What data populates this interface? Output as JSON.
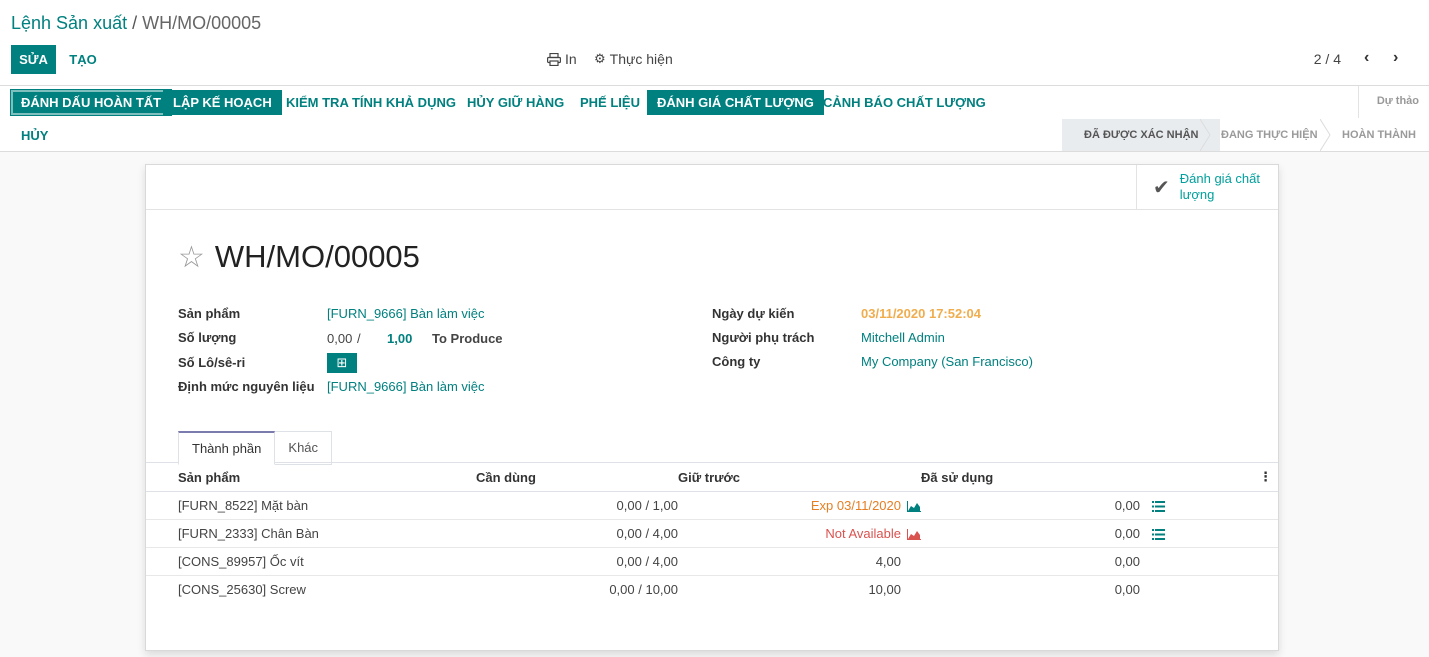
{
  "breadcrumb": {
    "parent": "Lệnh Sản xuất",
    "separator": "/",
    "current": "WH/MO/00005"
  },
  "toolbar": {
    "edit_label": "Sửa",
    "create_label": "Tạo",
    "print_label": "In",
    "action_label": "Thực hiện",
    "pager": "2 / 4"
  },
  "statusbar": {
    "buttons": [
      "Đánh dấu hoàn tất",
      "Lập kế hoạch",
      "Kiểm tra tính khả dụng",
      "Hủy giữ hàng",
      "Phế liệu",
      "Đánh giá chất lượng",
      "Cảnh báo chất lượng"
    ],
    "cancel_label": "Hủy",
    "stages": {
      "draft": "Dự thảo",
      "confirmed": "Đã được xác nhận",
      "progress": "Đang thực hiện",
      "done": "Hoàn thành"
    }
  },
  "smart_button": {
    "label": "Đánh giá chất lượng"
  },
  "record": {
    "name": "WH/MO/00005"
  },
  "fields": {
    "product_label": "Sản phẩm",
    "product_value": "[FURN_9666] Bàn làm việc",
    "qty_label": "Số lượng",
    "qty_produced": "0,00",
    "qty_sep": "/",
    "qty_total": "1,00",
    "qty_suffix": "To Produce",
    "lot_label": "Số Lô/sê-ri",
    "bom_label": "Định mức nguyên liệu",
    "bom_value": "[FURN_9666] Bàn làm việc",
    "date_label": "Ngày dự kiến",
    "date_value": "03/11/2020 17:52:04",
    "user_label": "Người phụ trách",
    "user_value": "Mitchell Admin",
    "company_label": "Công ty",
    "company_value": "My Company (San Francisco)"
  },
  "tabs": {
    "components": "Thành phần",
    "other": "Khác"
  },
  "table": {
    "headers": {
      "product": "Sản phẩm",
      "to_consume": "Cần dùng",
      "reserved": "Giữ trước",
      "consumed": "Đã sử dụng"
    },
    "rows": [
      {
        "product": "[FURN_8522] Mặt bàn",
        "to_consume": "0,00 / 1,00",
        "reserved": "Exp 03/11/2020",
        "consumed": "0,00"
      },
      {
        "product": "[FURN_2333] Chân Bàn",
        "to_consume": "0,00 / 4,00",
        "reserved": "Not Available",
        "consumed": "0,00"
      },
      {
        "product": "[CONS_89957] Ốc vít",
        "to_consume": "0,00 / 4,00",
        "reserved": "4,00",
        "consumed": "0,00"
      },
      {
        "product": "[CONS_25630] Screw",
        "to_consume": "0,00 / 10,00",
        "reserved": "10,00",
        "consumed": "0,00"
      }
    ]
  },
  "colors": {
    "brand": "#00807f",
    "accent": "#00A09D",
    "warning": "#e67e22",
    "danger": "#d9534f",
    "success": "#28a745"
  }
}
